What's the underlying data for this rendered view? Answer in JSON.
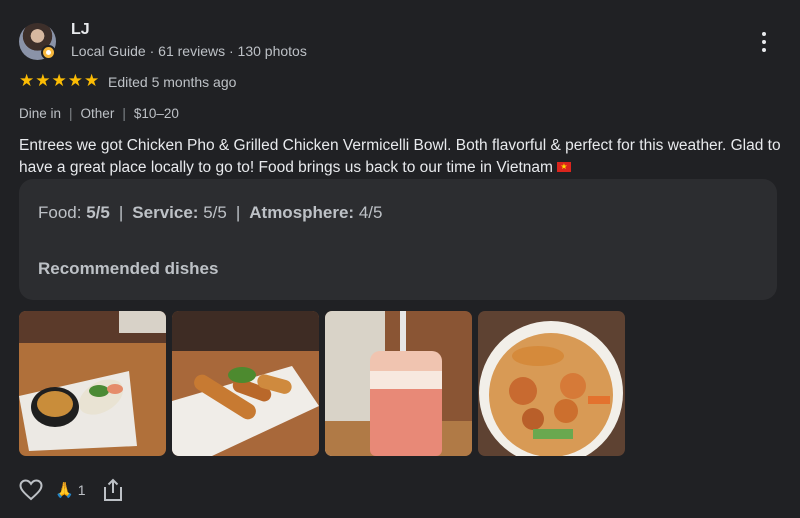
{
  "reviewer": {
    "name": "LJ",
    "guide_label": "Local Guide",
    "reviews": "61 reviews",
    "photos": "130 photos",
    "dot": "·"
  },
  "rating": {
    "stars": 5,
    "star_glyph": "★",
    "star_color": "#fbbc04",
    "edited": "Edited 5 months ago"
  },
  "meta": {
    "service": "Dine in",
    "meal": "Other",
    "price": "$10–20",
    "separator": "|"
  },
  "review_text": "Entrees we got Chicken Pho & Grilled Chicken Vermicelli Bowl. Both flavorful & perfect for this weather. Glad to have a great place locally to go to! Food brings us back to our time in Vietnam",
  "flag_icon": "vietnam-flag-icon",
  "attributes": {
    "food_label": "Food:",
    "food_value": "5/5",
    "service_label": "Service:",
    "service_value": "5/5",
    "atmosphere_label": "Atmosphere:",
    "atmosphere_value": "4/5",
    "recommended_label": "Recommended dishes"
  },
  "photos": [
    {
      "icon": "spring-rolls-photo"
    },
    {
      "icon": "grilled-rolls-photo"
    },
    {
      "icon": "pink-drink-photo"
    },
    {
      "icon": "vermicelli-bowl-photo"
    }
  ],
  "actions": {
    "like_icon": "heart-icon",
    "reaction_emoji": "🙏",
    "reaction_count": "1",
    "share_icon": "share-icon"
  }
}
